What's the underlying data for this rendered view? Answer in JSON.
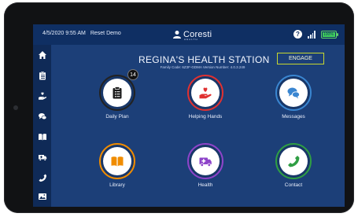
{
  "status_bar": {
    "datetime": "4/5/2020 9:55 AM",
    "reset_label": "Reset Demo",
    "logo_text": "Coresti",
    "logo_sub": "HEALTH",
    "battery_label": "100%"
  },
  "header": {
    "title": "REGINA'S HEALTH STATION",
    "subtitle": "Family Code: 6Z3F-GDMA  Version Number: 4.0.3.249",
    "engage_label": "ENGAGE"
  },
  "sidebar": {
    "items": [
      {
        "icon": "home-icon"
      },
      {
        "icon": "clipboard-icon"
      },
      {
        "icon": "helping-hands-icon"
      },
      {
        "icon": "chat-icon"
      },
      {
        "icon": "book-icon"
      },
      {
        "icon": "ambulance-icon"
      },
      {
        "icon": "phone-icon"
      },
      {
        "icon": "photo-icon"
      }
    ]
  },
  "tiles": [
    {
      "label": "Daily Plan",
      "badge": "14",
      "ring_color": "#1a1a1a",
      "icon": "clipboard-icon",
      "icon_color": "#1a1a1a"
    },
    {
      "label": "Helping Hands",
      "ring_color": "#e03131",
      "icon": "helping-hands-icon",
      "icon_color": "#e03131"
    },
    {
      "label": "Messages",
      "ring_color": "#3a86d1",
      "icon": "chat-icon",
      "icon_color": "#3a86d1"
    },
    {
      "label": "Library",
      "ring_color": "#f08c00",
      "icon": "book-icon",
      "icon_color": "#f08c00"
    },
    {
      "label": "Health",
      "ring_color": "#8e44c9",
      "icon": "ambulance-icon",
      "icon_color": "#8e44c9"
    },
    {
      "label": "Contact",
      "ring_color": "#2f9e44",
      "icon": "phone-icon",
      "icon_color": "#2f9e44"
    }
  ],
  "colors": {
    "screen_bg": "#1c3f78",
    "status_bg": "#0f2f63",
    "sidebar_bg": "#0f2a57",
    "engage_border": "#c7d72f"
  }
}
